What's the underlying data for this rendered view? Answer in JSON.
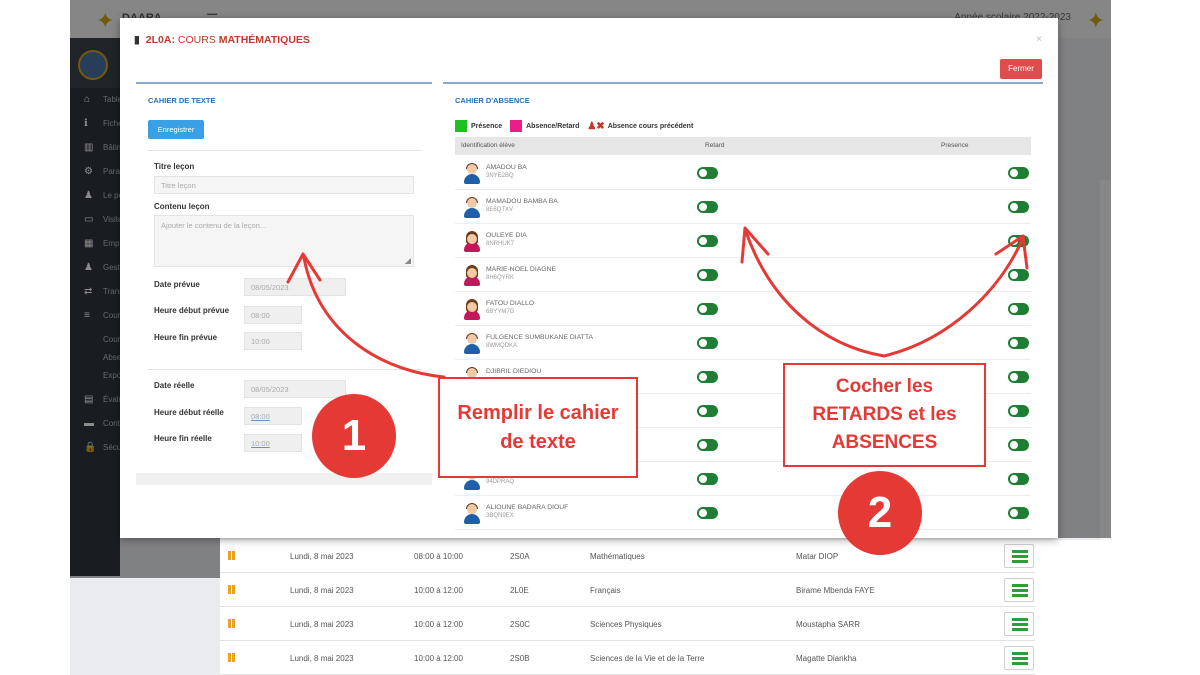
{
  "background": {
    "brand": "DAARA",
    "top_right": "Année scolaire 2022-2023",
    "sidebar_items": [
      {
        "icon": "home-icon",
        "label": "Tableau de bord"
      },
      {
        "icon": "info-icon",
        "label": "Fiche"
      },
      {
        "icon": "building-icon",
        "label": "Bâtiment"
      },
      {
        "icon": "gear-icon",
        "label": "Paramètres"
      },
      {
        "icon": "user-icon",
        "label": "Le personnel"
      },
      {
        "icon": "monitor-icon",
        "label": "Visite"
      },
      {
        "icon": "calendar-icon",
        "label": "Emploi du temps"
      },
      {
        "icon": "user-icon",
        "label": "Gestion"
      },
      {
        "icon": "transfer-icon",
        "label": "Transfert"
      },
      {
        "icon": "list-icon",
        "label": "Cours"
      },
      {
        "icon": "",
        "label": "Cours"
      },
      {
        "icon": "",
        "label": "Absences"
      },
      {
        "icon": "",
        "label": "Export"
      },
      {
        "icon": "book-icon",
        "label": "Évaluations"
      },
      {
        "icon": "folder-icon",
        "label": "Contenus"
      },
      {
        "icon": "lock-icon",
        "label": "Sécurité"
      }
    ],
    "table_rows": [
      {
        "date": "Lundi, 8 mai 2023",
        "time": "08:00 à 10:00",
        "class": "2S0A",
        "subject": "Mathématiques",
        "teacher": "Matar DIOP"
      },
      {
        "date": "Lundi, 8 mai 2023",
        "time": "10:00 à 12:00",
        "class": "2L0E",
        "subject": "Français",
        "teacher": "Birame Mbenda FAYE"
      },
      {
        "date": "Lundi, 8 mai 2023",
        "time": "10:00 à 12:00",
        "class": "2S0C",
        "subject": "Sciences Physiques",
        "teacher": "Moustapha SARR"
      },
      {
        "date": "Lundi, 8 mai 2023",
        "time": "10:00 à 12:00",
        "class": "2S0B",
        "subject": "Sciences de la Vie et de la Terre",
        "teacher": "Magatte Diankha"
      }
    ]
  },
  "modal": {
    "class_code": "2L0A:",
    "course_prefix": "COURS",
    "course_subject": "MATHÉMATIQUES",
    "close_label": "Fermer",
    "close_x": "×"
  },
  "cahier_texte": {
    "title": "CAHIER DE TEXTE",
    "save_label": "Enregistrer",
    "titre_label": "Titre leçon",
    "titre_placeholder": "Titre leçon",
    "contenu_label": "Contenu leçon",
    "contenu_placeholder": "Ajouter le contenu de la leçon...",
    "date_prevue_label": "Date prévue",
    "date_prevue": "08/05/2023",
    "debut_prevue_label": "Heure début prévue",
    "debut_prevue": "08:00",
    "fin_prevue_label": "Heure fin prévue",
    "fin_prevue": "10:00",
    "date_reelle_label": "Date réelle",
    "date_reelle": "08/05/2023",
    "debut_reelle_label": "Heure début réelle",
    "debut_reelle": "08:00",
    "fin_reelle_label": "Heure fin réelle",
    "fin_reelle": "10:00"
  },
  "cahier_absence": {
    "title": "CAHIER D'ABSENCE",
    "legend": {
      "presence": "Présence",
      "absence_retard": "Absence/Retard",
      "absence_precedent": "Absence cours précédent",
      "presence_color": "#1fbf1f",
      "absence_color": "#e91e8c"
    },
    "columns": {
      "identification": "Identification élève",
      "retard": "Retard",
      "presence": "Presence"
    },
    "students": [
      {
        "name": "AMADOU BA",
        "id": "3NYE2BQ",
        "gender": "male"
      },
      {
        "name": "MAMADOU BAMBA BA",
        "id": "8E6QTXV",
        "gender": "male"
      },
      {
        "name": "OULEYE DIA",
        "id": "8NRHUK7",
        "gender": "female"
      },
      {
        "name": "MARIE-NOEL DIAGNE",
        "id": "8H6QYRK",
        "gender": "female"
      },
      {
        "name": "FATOU DIALLO",
        "id": "6BYYM7G",
        "gender": "female"
      },
      {
        "name": "FULGENCE SUMBUKANE DIATTA",
        "id": "8WMQDKA",
        "gender": "male"
      },
      {
        "name": "DJIBRIL DIEDIOU",
        "id": "",
        "gender": "male"
      },
      {
        "name": "",
        "id": "",
        "gender": "male"
      },
      {
        "name": "",
        "id": "",
        "gender": "male"
      },
      {
        "name": "",
        "id": "94DPRAQ",
        "gender": "male"
      },
      {
        "name": "ALIOUNE BADARA DIOUF",
        "id": "3BQN9EX",
        "gender": "male"
      }
    ]
  },
  "annotations": {
    "callout1_line1": "Remplir le cahier",
    "callout1_line2": "de texte",
    "badge1": "1",
    "callout2_line1": "Cocher les",
    "callout2_line2": "RETARDS et les",
    "callout2_line3": "ABSENCES",
    "badge2": "2",
    "accent_color": "#e53935"
  }
}
